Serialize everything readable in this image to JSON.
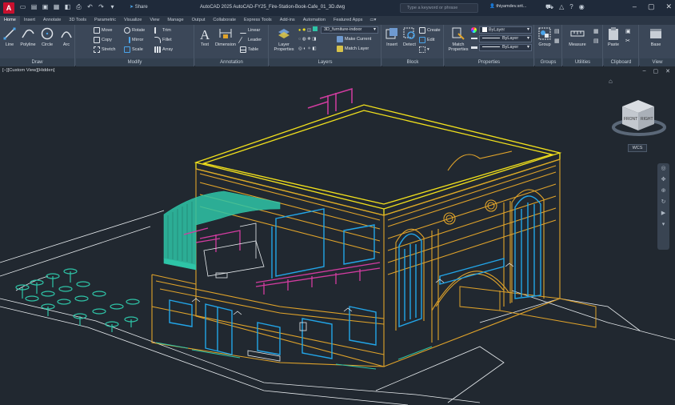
{
  "titlebar": {
    "logo": "A",
    "share_label": "Share",
    "app_title": "AutoCAD 2025   AutoCAD-FY25_Fire-Station-Book-Cafe_01_3D.dwg",
    "search_placeholder": "Type a keyword or phrase",
    "user": "thiyamdev.srit..."
  },
  "tabs": [
    {
      "label": "Home"
    },
    {
      "label": "Insert"
    },
    {
      "label": "Annotate"
    },
    {
      "label": "3D Tools"
    },
    {
      "label": "Parametric"
    },
    {
      "label": "Visualize"
    },
    {
      "label": "View"
    },
    {
      "label": "Manage"
    },
    {
      "label": "Output"
    },
    {
      "label": "Collaborate"
    },
    {
      "label": "Express Tools"
    },
    {
      "label": "Add-ins"
    },
    {
      "label": "Automation"
    },
    {
      "label": "Featured Apps"
    }
  ],
  "ribbon": {
    "draw": {
      "title": "Draw",
      "line": "Line",
      "polyline": "Polyline",
      "circle": "Circle",
      "arc": "Arc"
    },
    "modify": {
      "title": "Modify",
      "move": "Move",
      "rotate": "Rotate",
      "trim": "Trim",
      "copy": "Copy",
      "mirror": "Mirror",
      "fillet": "Fillet",
      "stretch": "Stretch",
      "scale": "Scale",
      "array": "Array"
    },
    "annotation": {
      "title": "Annotation",
      "text": "Text",
      "dimension": "Dimension",
      "linear": "Linear",
      "leader": "Leader",
      "table": "Table"
    },
    "layers": {
      "title": "Layers",
      "layer_properties_1": "Layer",
      "layer_properties_2": "Properties",
      "current_layer": "3D_furniture-indoor",
      "make_current": "Make Current",
      "match_layer": "Match Layer"
    },
    "block": {
      "title": "Block",
      "insert": "Insert",
      "detect": "Detect",
      "create": "Create",
      "edit": "Edit"
    },
    "properties": {
      "title": "Properties",
      "match_1": "Match",
      "match_2": "Properties",
      "color": "ByLayer",
      "linetype": "ByLayer",
      "lineweight": "ByLayer"
    },
    "groups": {
      "title": "Groups",
      "group": "Group"
    },
    "utilities": {
      "title": "Utilities",
      "measure": "Measure"
    },
    "clipboard": {
      "title": "Clipboard",
      "paste": "Paste"
    },
    "view": {
      "title": "View",
      "base": "Base"
    }
  },
  "viewport": {
    "label": "[−][Custom View][Hidden]",
    "wcs": "WCS",
    "viewcube": {
      "front": "FRONT",
      "right": "RIGHT"
    }
  },
  "colors": {
    "yellow": "#f2e11c",
    "orange": "#e0a32a",
    "cyan": "#22a5e8",
    "teal": "#2ec4a7",
    "magenta": "#d23ca0",
    "white": "#e8ecef"
  }
}
